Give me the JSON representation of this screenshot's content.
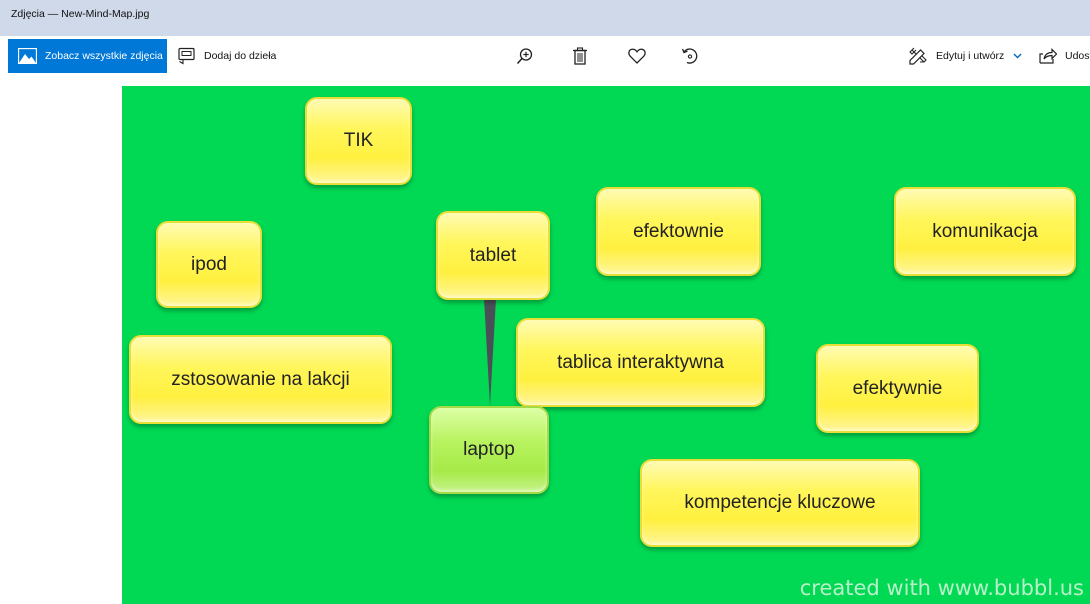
{
  "window": {
    "title": "Zdjęcia — New-Mind-Map.jpg"
  },
  "toolbar": {
    "see_all_label": "Zobacz wszystkie zdjęcia",
    "add_to_creation_label": "Dodaj do dzieła",
    "edit_create_label": "Edytuj i utwórz",
    "share_label": "Udost",
    "icons": [
      "zoom-in-icon",
      "trash-icon",
      "heart-icon",
      "rotate-icon",
      "edit-create-icon",
      "share-icon"
    ]
  },
  "mindmap": {
    "background": "#01d954",
    "bubble_color": "#fff03f",
    "center_bubble_color": "#a6ea48",
    "nodes": {
      "tik": "TIK",
      "ipod": "ipod",
      "tablet": "tablet",
      "efektownie": "efektownie",
      "komunikacja": "komunikacja",
      "zastosowanie": "zstosowanie na lakcji",
      "tablica": "tablica interaktywna",
      "efektywnie": "efektywnie",
      "laptop": "laptop",
      "kompetencje": "kompetencje kluczowe"
    },
    "watermark": "created with www.bubbl.us"
  }
}
